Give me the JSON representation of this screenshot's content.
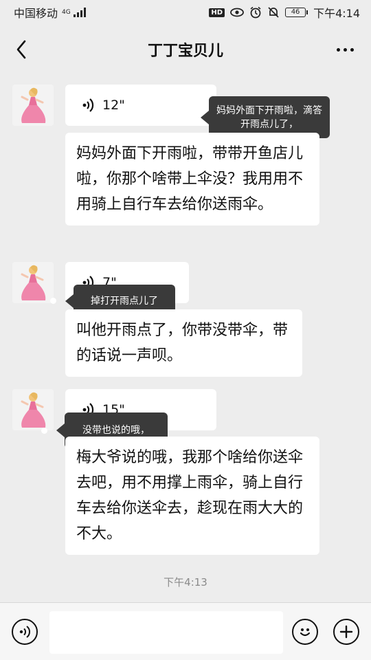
{
  "status_bar": {
    "carrier": "中国移动",
    "network": "4G",
    "battery": "46",
    "time": "下午4:14",
    "icons": [
      "hd-icon",
      "eye-icon",
      "alarm-icon",
      "mute-icon",
      "battery-icon"
    ]
  },
  "header": {
    "title": "丁丁宝贝儿",
    "back_icon": "back-arrow-icon",
    "more_icon": "more-dots-icon"
  },
  "messages": [
    {
      "voice_duration": "12\"",
      "transcription": "妈妈外面下开雨啦，带带开鱼店儿啦，你那个啥带上伞没？我用用不用骑上自行车去给你送雨伞。",
      "tooltip": "妈妈外面下开雨啦，滴答开雨点儿了，"
    },
    {
      "voice_duration": "7\"",
      "transcription": "叫他开雨点了，你带没带伞，带的话说一声呗。",
      "tooltip": "掉打开雨点儿了"
    },
    {
      "voice_duration": "15\"",
      "transcription": "梅大爷说的哦，我那个啥给你送伞去吧，用不用撑上雨伞，骑上自行车去给你送伞去，趁现在雨大大的不大。",
      "tooltip": "没带也说的哦，"
    }
  ],
  "timestamp": "下午4:13",
  "input_bar": {
    "voice_icon": "voice-mode-icon",
    "emoji_icon": "emoji-icon",
    "plus_icon": "plus-icon",
    "input_value": ""
  },
  "colors": {
    "background": "#ededed",
    "bubble": "#ffffff",
    "tooltip": "#3a3a3a",
    "avatar_dress": "#e8709a"
  }
}
